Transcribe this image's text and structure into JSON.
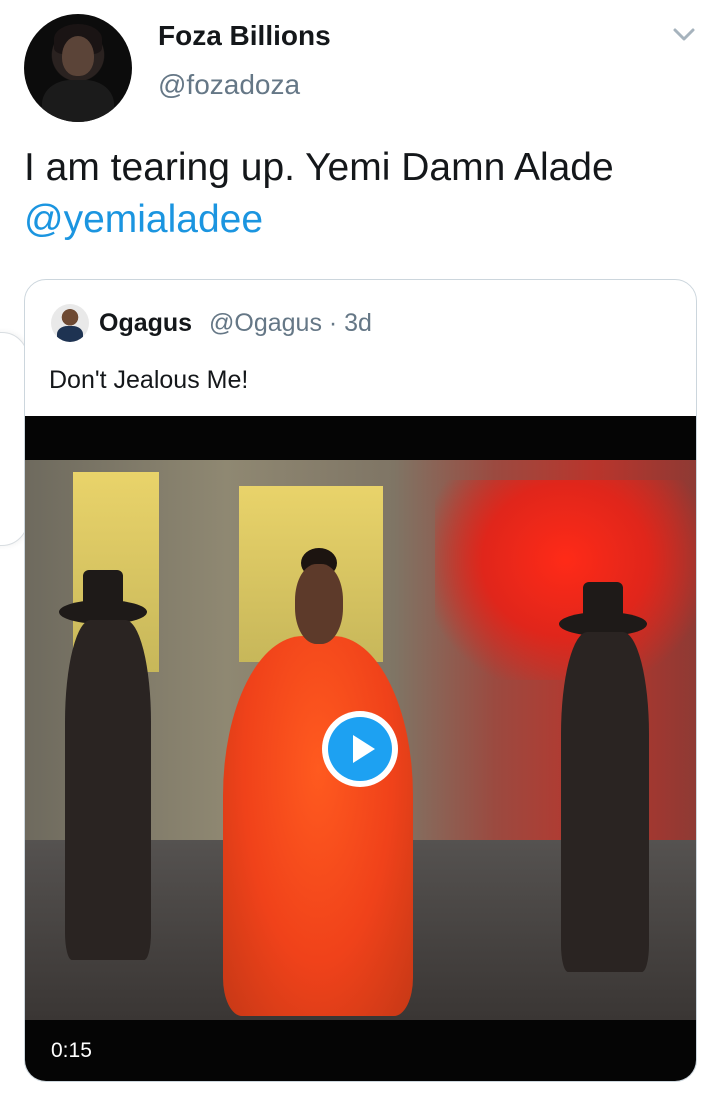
{
  "author": {
    "display_name": "Foza Billions",
    "handle": "@fozadoza"
  },
  "tweet": {
    "text": "I am tearing up. Yemi Damn Alade",
    "mention": "@yemialadee"
  },
  "quoted_tweet": {
    "display_name": "Ogagus",
    "meta": "@Ogagus · 3d",
    "text": "Don't Jealous Me!",
    "video": {
      "duration": "0:15"
    }
  },
  "colors": {
    "link": "#1b95e0",
    "play_button": "#1da1f2",
    "secondary_text": "#657786"
  },
  "icons": {
    "menu": "chevron-down-icon",
    "play": "play-icon"
  }
}
